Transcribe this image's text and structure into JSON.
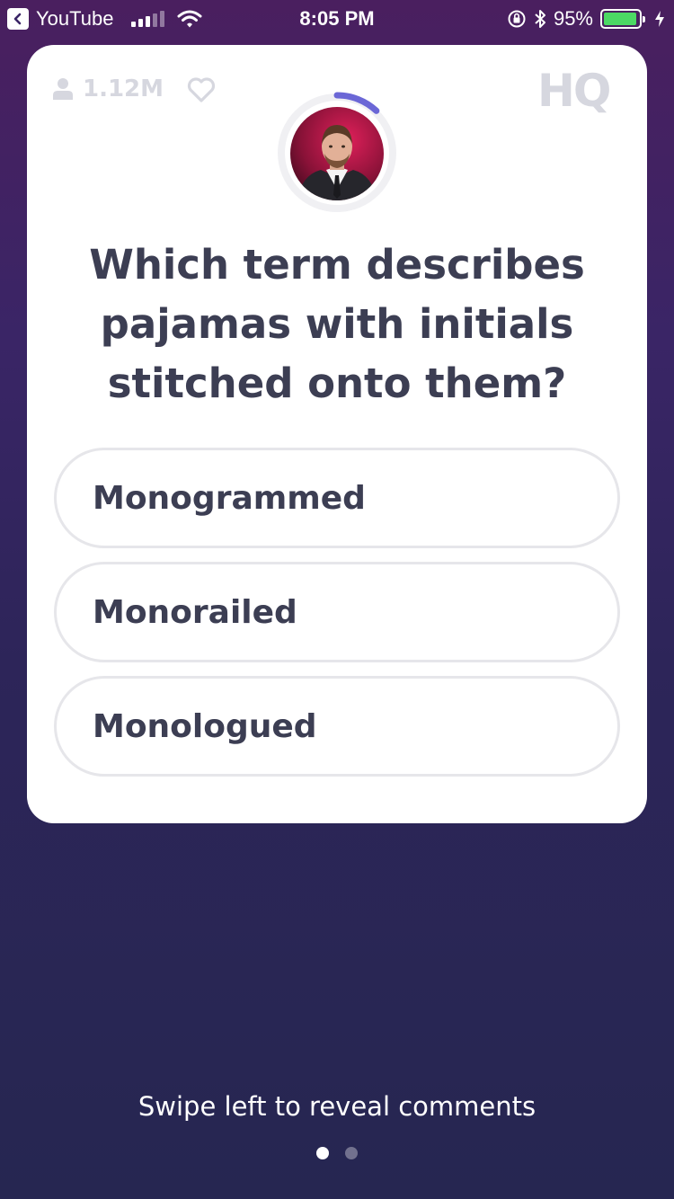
{
  "status_bar": {
    "back_app": "YouTube",
    "time": "8:05 PM",
    "battery_percent": "95%",
    "battery_level": 0.95
  },
  "card": {
    "viewer_count": "1.12M",
    "logo": "HQ",
    "timer_progress": 0.12,
    "question": "Which term describes pajamas with initials stitched onto them?",
    "answers": [
      "Monogrammed",
      "Monorailed",
      "Monologued"
    ]
  },
  "footer": {
    "swipe_hint": "Swipe left to reveal comments",
    "page_index": 0,
    "page_count": 2
  },
  "colors": {
    "text_dark": "#3c3e53",
    "muted": "#d6d7df",
    "timer_arc": "#6b67d6",
    "battery": "#4cd964"
  }
}
